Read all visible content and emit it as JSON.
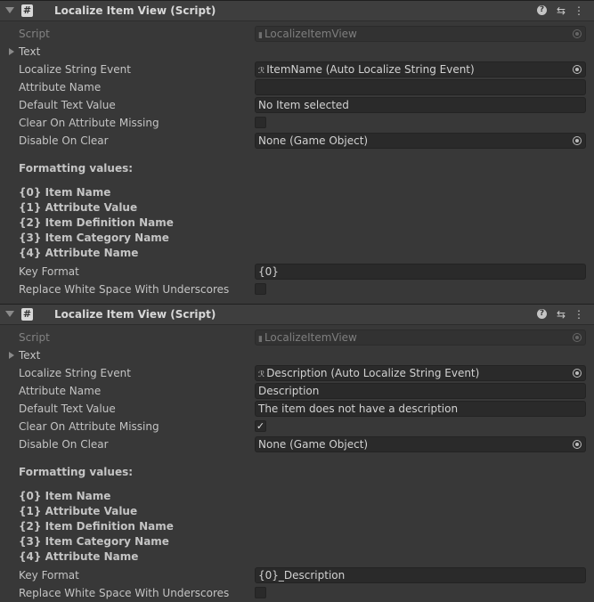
{
  "components": [
    {
      "title": "Localize Item View (Script)",
      "script_label": "Script",
      "script_value": "LocalizeItemView",
      "text_foldout": "Text",
      "fields": {
        "lse_label": "Localize String Event",
        "lse_value": "ItemName (Auto Localize String Event)",
        "attr_label": "Attribute Name",
        "attr_value": "",
        "default_label": "Default Text Value",
        "default_value": "No Item selected",
        "clear_label": "Clear On Attribute Missing",
        "clear_checked": false,
        "disable_label": "Disable On Clear",
        "disable_value": "None (Game Object)"
      },
      "formatting_title": "Formatting values:",
      "formatting_values": [
        "{0} Item Name",
        "{1} Attribute Value",
        "{2} Item Definition Name",
        "{3} Item Category Name",
        "{4} Attribute Name"
      ],
      "key_format_label": "Key Format",
      "key_format_value": "{0}",
      "replace_label": "Replace White Space With Underscores",
      "replace_checked": false
    },
    {
      "title": "Localize Item View (Script)",
      "script_label": "Script",
      "script_value": "LocalizeItemView",
      "text_foldout": "Text",
      "fields": {
        "lse_label": "Localize String Event",
        "lse_value": "Description (Auto Localize String Event)",
        "attr_label": "Attribute Name",
        "attr_value": "Description",
        "default_label": "Default Text Value",
        "default_value": "The item does not have a description",
        "clear_label": "Clear On Attribute Missing",
        "clear_checked": true,
        "disable_label": "Disable On Clear",
        "disable_value": "None (Game Object)"
      },
      "formatting_title": "Formatting values:",
      "formatting_values": [
        "{0} Item Name",
        "{1} Attribute Value",
        "{2} Item Definition Name",
        "{3} Item Category Name",
        "{4} Attribute Name"
      ],
      "key_format_label": "Key Format",
      "key_format_value": "{0}_Description",
      "replace_label": "Replace White Space With Underscores",
      "replace_checked": false
    }
  ],
  "icons": {
    "script": "hash-script-icon",
    "help": "help-icon",
    "presets": "presets-sliders-icon",
    "menu": "kebab-menu-icon",
    "object_picker": "object-picker-icon"
  },
  "glyphs": {
    "script": "#",
    "help": "?",
    "presets": "⇆",
    "menu": "⋮",
    "check": "✓",
    "lse": "ℛ"
  },
  "colors": {
    "background": "#383838",
    "header": "#3e3e3e",
    "field": "#2a2a2a",
    "text": "#c4c4c4"
  }
}
